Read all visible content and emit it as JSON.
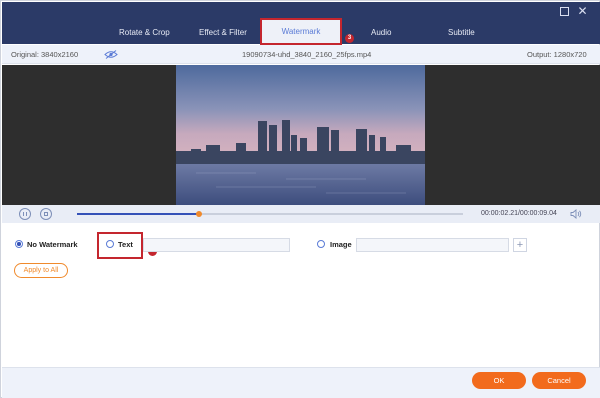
{
  "window": {
    "maximize_icon": "maximize-icon",
    "close_icon": "close-icon"
  },
  "tabs": [
    {
      "label": "Rotate & Crop"
    },
    {
      "label": "Effect & Filter"
    },
    {
      "label": "Watermark",
      "active": true
    },
    {
      "label": "Audio"
    },
    {
      "label": "Subtitle"
    }
  ],
  "steps": {
    "watermark_step": "3",
    "text_step": "4"
  },
  "filebar": {
    "original": "Original: 3840x2160",
    "filename": "19090734-uhd_3840_2160_25fps.mp4",
    "output": "Output: 1280x720"
  },
  "playback": {
    "time": "00:00:02.21/00:00:09.04",
    "progress": 0.315
  },
  "watermark": {
    "no_watermark_label": "No Watermark",
    "no_watermark_selected": true,
    "text_label": "Text",
    "text_value": "",
    "image_label": "Image",
    "image_value": "",
    "plus_label": "+",
    "apply_label": "Apply to All"
  },
  "footer": {
    "ok_label": "OK",
    "cancel_label": "Cancel"
  },
  "colors": {
    "header": "#2b3a67",
    "accent": "#3552b8",
    "orange": "#f26b1d",
    "highlight": "#c4262e"
  }
}
